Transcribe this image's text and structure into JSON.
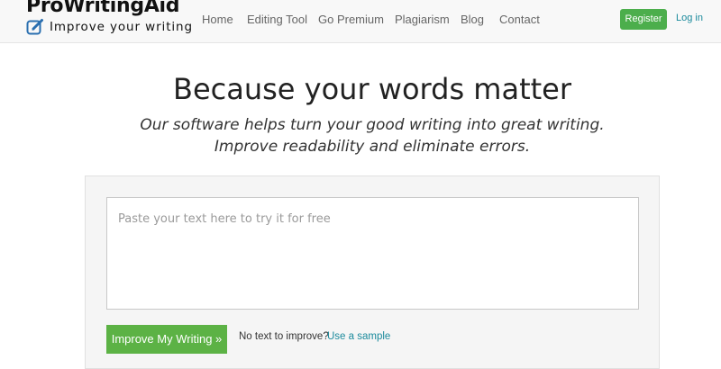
{
  "header": {
    "logo": {
      "name": "ProWritingAid",
      "tagline": "Improve your writing",
      "icon": "pencil-edit-icon"
    },
    "nav": {
      "home": "Home",
      "editing_tool": "Editing Tool",
      "go_premium": "Go Premium",
      "plagiarism": "Plagiarism",
      "blog": "Blog",
      "contact": "Contact"
    },
    "register_label": "Register",
    "login_label": "Log in"
  },
  "hero": {
    "title": "Because your words matter",
    "subtitle_line1": "Our software helps turn your good writing into great writing.",
    "subtitle_line2": "Improve readability and eliminate errors."
  },
  "editor": {
    "value": "",
    "placeholder": "Paste your text here to try it for free",
    "submit_label": "Improve My Writing »",
    "no_text_prompt": "No text to improve?",
    "sample_link": "Use a sample"
  },
  "colors": {
    "accent_green": "#5cb245",
    "register_green": "#4cae4c",
    "link_teal": "#1b8a9c",
    "header_bg": "#f8f8f8"
  }
}
